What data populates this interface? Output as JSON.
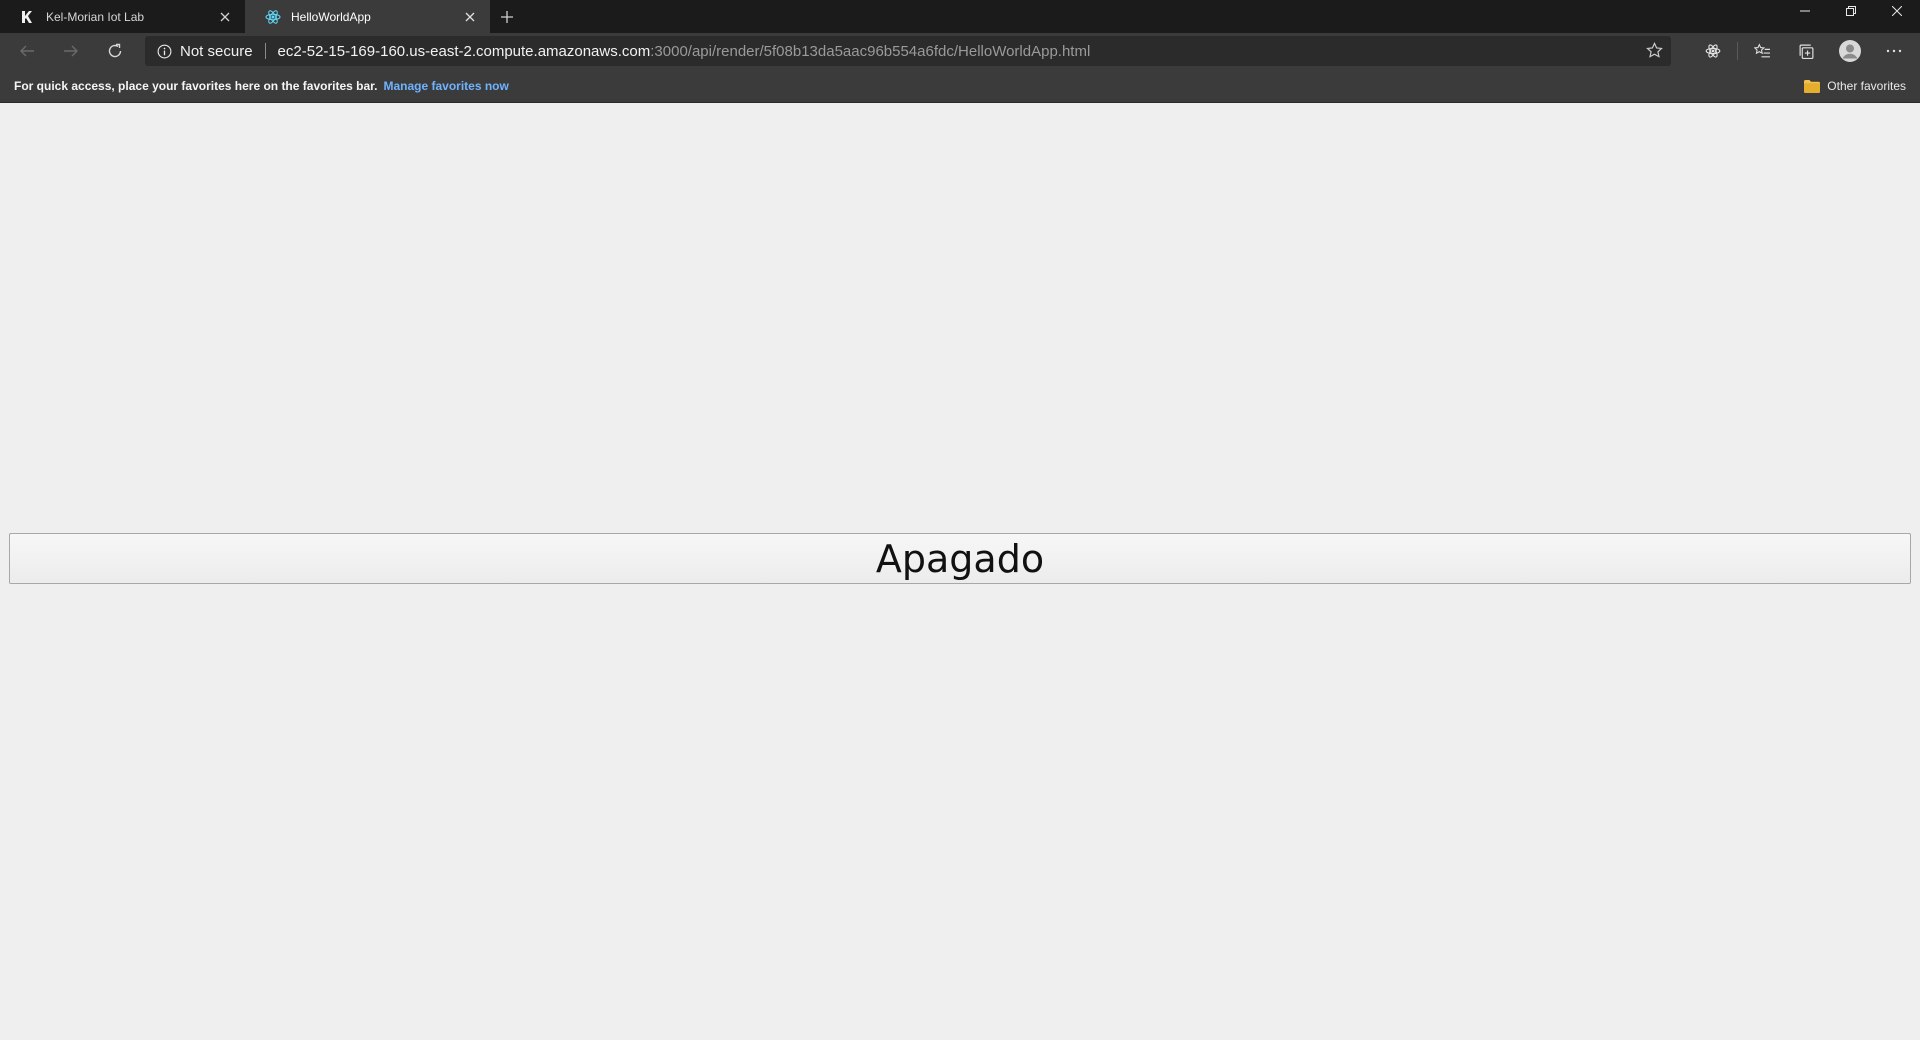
{
  "browser": {
    "tabs": [
      {
        "title": "Kel-Morian Iot Lab",
        "icon": "km-logo-icon",
        "active": false
      },
      {
        "title": "HelloWorldApp",
        "icon": "react-logo-icon",
        "active": true
      }
    ],
    "address_bar": {
      "security_label": "Not secure",
      "url_host": "ec2-52-15-169-160.us-east-2.compute.amazonaws.com",
      "url_path": ":3000/api/render/5f08b13da5aac96b554a6fdc/HelloWorldApp.html"
    },
    "favorites_bar": {
      "message": "For quick access, place your favorites here on the favorites bar.",
      "link_label": "Manage favorites now",
      "other_favorites_label": "Other favorites"
    }
  },
  "app": {
    "toggle_button_label": "Apagado"
  },
  "colors": {
    "tab_strip": "#1b1b1b",
    "toolbar": "#3b3b3b",
    "link": "#6fb3ff",
    "page_background": "#efefef"
  }
}
